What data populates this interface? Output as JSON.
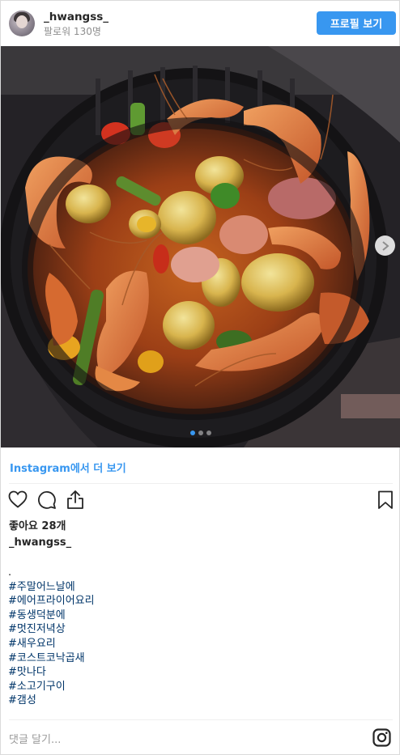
{
  "header": {
    "username": "_hwangss_",
    "followers": "팔로워 130명",
    "profile_button": "프로필 보기"
  },
  "carousel": {
    "image_description": "air fryer basket with shrimp, potatoes and vegetables",
    "current": 1,
    "total": 3
  },
  "view_more": "Instagram에서 더 보기",
  "actions": {
    "like_icon": "heart-icon",
    "comment_icon": "comment-icon",
    "share_icon": "share-icon",
    "save_icon": "bookmark-icon"
  },
  "likes": "좋아요 28개",
  "caption": {
    "username": "_hwangss_",
    "first_line": ".",
    "hashtags": [
      "#주말어느날에",
      "#에어프라이어요리",
      "#동생덕분에",
      "#멋진저녁상",
      "#새우요리",
      "#코스트코낙곱새",
      "#맛나다",
      "#소고기구이",
      "#갬성"
    ]
  },
  "comment_placeholder": "댓글 달기...",
  "colors": {
    "accent": "#3897f0",
    "hashtag": "#003569",
    "muted": "#8e8e8e"
  }
}
